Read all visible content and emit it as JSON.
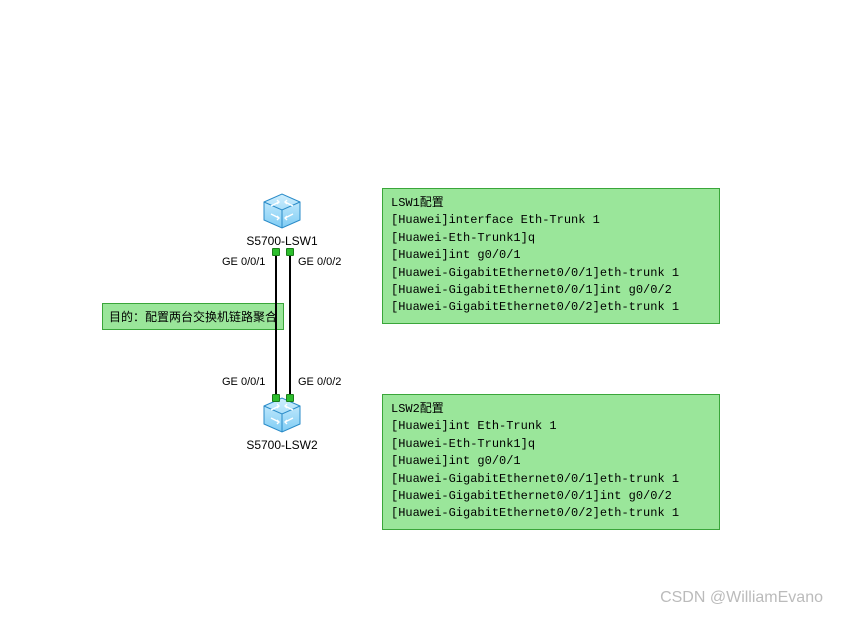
{
  "goal": {
    "text": "目的：配置两台交换机链路聚合"
  },
  "devices": {
    "lsw1": {
      "label": "S5700-LSW1"
    },
    "lsw2": {
      "label": "S5700-LSW2"
    }
  },
  "ports": {
    "lsw1": {
      "p1": "GE 0/0/1",
      "p2": "GE 0/0/2"
    },
    "lsw2": {
      "p1": "GE 0/0/1",
      "p2": "GE 0/0/2"
    }
  },
  "configs": {
    "lsw1": {
      "title": "LSW1配置",
      "lines": [
        "[Huawei]interface Eth-Trunk 1",
        "[Huawei-Eth-Trunk1]q",
        "[Huawei]int g0/0/1",
        "[Huawei-GigabitEthernet0/0/1]eth-trunk 1",
        "[Huawei-GigabitEthernet0/0/1]int g0/0/2",
        "[Huawei-GigabitEthernet0/0/2]eth-trunk 1"
      ]
    },
    "lsw2": {
      "title": "LSW2配置",
      "lines": [
        "[Huawei]int Eth-Trunk 1",
        "[Huawei-Eth-Trunk1]q",
        "[Huawei]int g0/0/1",
        "[Huawei-GigabitEthernet0/0/1]eth-trunk 1",
        "[Huawei-GigabitEthernet0/0/1]int g0/0/2",
        "[Huawei-GigabitEthernet0/0/2]eth-trunk 1"
      ]
    }
  },
  "watermark": "CSDN @WilliamEvano",
  "colors": {
    "noteBg": "#9AE69A",
    "noteBorder": "#3AA63A",
    "link": "#000000"
  }
}
